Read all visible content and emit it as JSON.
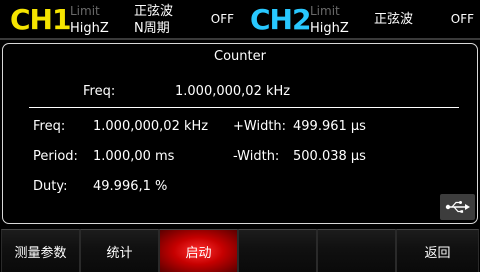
{
  "ch1": {
    "name": "CH1",
    "limit_label": "Limit",
    "impedance": "HighZ",
    "waveform": "正弦波",
    "mode": "N周期",
    "state": "OFF",
    "color": "#f5e400"
  },
  "ch2": {
    "name": "CH2",
    "limit_label": "Limit",
    "impedance": "HighZ",
    "waveform": "正弦波",
    "state": "OFF",
    "color": "#28c8ff"
  },
  "panel": {
    "title": "Counter",
    "main_freq_label": "Freq:",
    "main_freq_value": "1.000,000,02 kHz",
    "measurements": {
      "freq_label": "Freq:",
      "freq_value": "1.000,000,02 kHz",
      "period_label": "Period:",
      "period_value": "1.000,00 ms",
      "duty_label": "Duty:",
      "duty_value": "49.996,1 %",
      "pwidth_label": "+Width:",
      "pwidth_value": "499.961 µs",
      "nwidth_label": "-Width:",
      "nwidth_value": "500.038 µs"
    },
    "usb_icon": "usb-icon"
  },
  "softkeys": [
    {
      "label": "测量参数"
    },
    {
      "label": "统计"
    },
    {
      "label": "启动",
      "active": true
    },
    {
      "label": ""
    },
    {
      "label": ""
    },
    {
      "label": "返回"
    }
  ],
  "accent_active": "#e00000"
}
